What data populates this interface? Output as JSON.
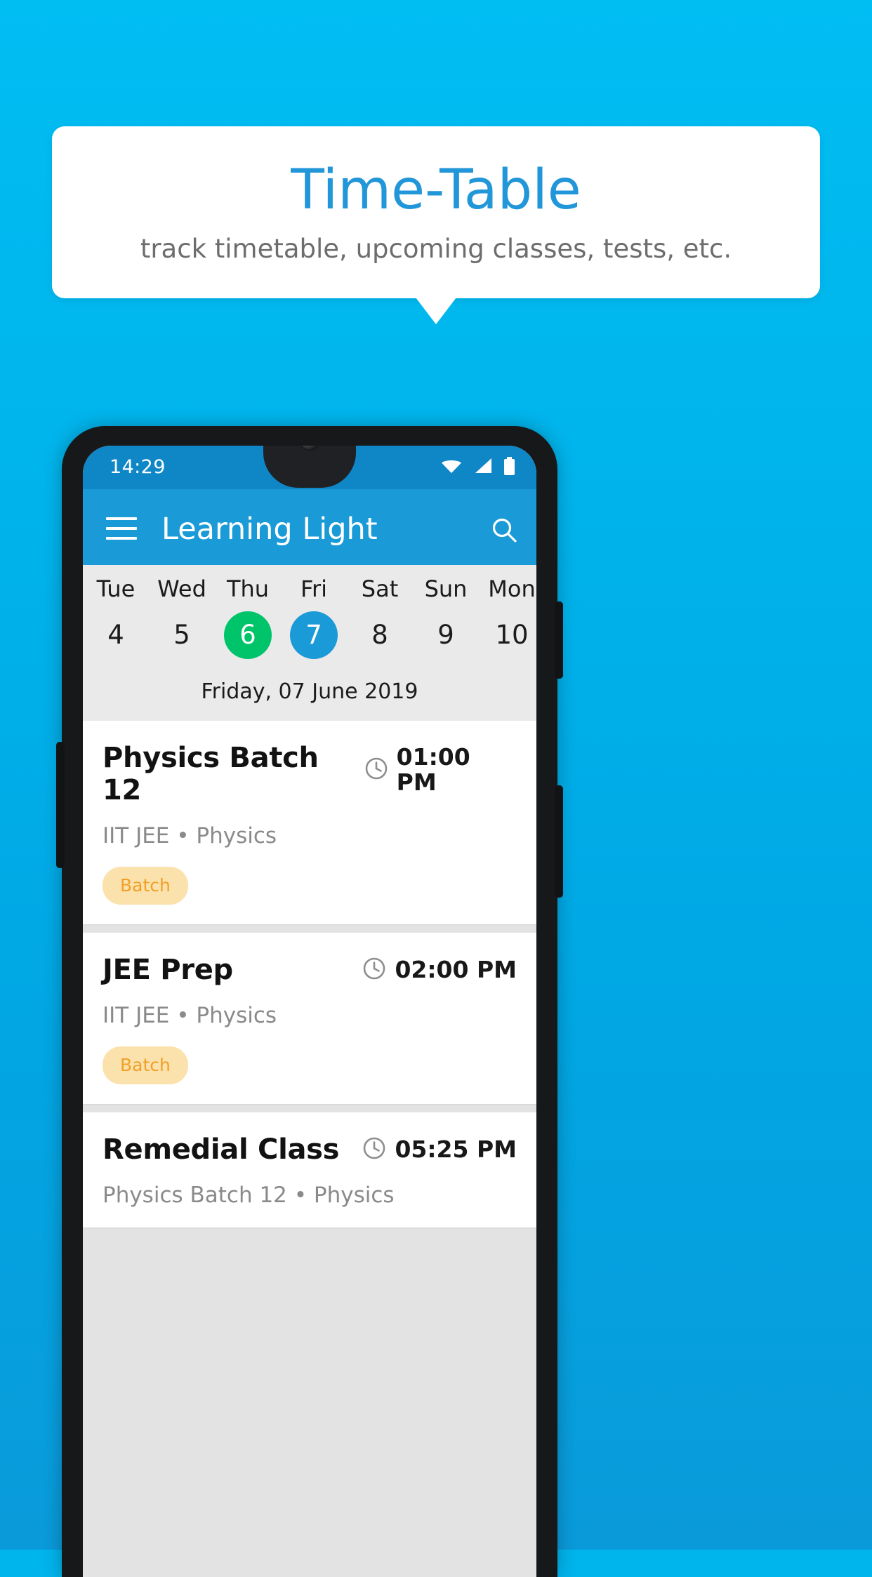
{
  "banner": {
    "title": "Time-Table",
    "subtitle": "track timetable, upcoming classes, tests, etc.",
    "title_color": "#2196d8",
    "subtitle_color": "#6d6d6d",
    "background_color": "#00b4ec"
  },
  "statusbar": {
    "time": "14:29",
    "icons": [
      "wifi-icon",
      "signal-icon",
      "battery-icon"
    ],
    "background_color": "#0f87c7"
  },
  "appbar": {
    "menu_icon": "hamburger-icon",
    "title": "Learning Light",
    "search_icon": "search-icon",
    "background_color": "#1a9ad7"
  },
  "datestrip": {
    "background_color": "#eaeaea",
    "today_color": "#00c46a",
    "selected_color": "#1a9ad7",
    "days": [
      {
        "name": "Tue",
        "num": "4",
        "state": "normal"
      },
      {
        "name": "Wed",
        "num": "5",
        "state": "normal"
      },
      {
        "name": "Thu",
        "num": "6",
        "state": "today"
      },
      {
        "name": "Fri",
        "num": "7",
        "state": "selected"
      },
      {
        "name": "Sat",
        "num": "8",
        "state": "normal"
      },
      {
        "name": "Sun",
        "num": "9",
        "state": "normal"
      },
      {
        "name": "Mon",
        "num": "10",
        "state": "normal"
      }
    ],
    "date_label": "Friday, 07 June 2019"
  },
  "schedule": {
    "items": [
      {
        "title": "Physics Batch 12",
        "time": "01:00 PM",
        "subtitle": "IIT JEE • Physics",
        "chip": "Batch",
        "clock_icon": "clock-icon"
      },
      {
        "title": "JEE Prep",
        "time": "02:00 PM",
        "subtitle": "IIT JEE • Physics",
        "chip": "Batch",
        "clock_icon": "clock-icon"
      },
      {
        "title": "Remedial Class",
        "time": "05:25 PM",
        "subtitle": "Physics Batch 12 • Physics",
        "chip": "",
        "clock_icon": "clock-icon"
      }
    ]
  }
}
